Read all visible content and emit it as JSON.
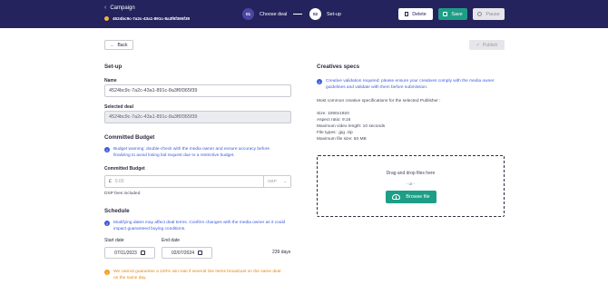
{
  "header": {
    "breadcrumb": "Campaign",
    "deal_id": "4524bc9c-7a2c-43a1-891c-8a3f6f365f39",
    "steps": [
      {
        "num": "01",
        "label": "Choose deal"
      },
      {
        "num": "02",
        "label": "Set-up"
      }
    ],
    "buttons": {
      "delete": "Delete",
      "save": "Save",
      "pause": "Pause"
    }
  },
  "toolbar": {
    "back": "Back",
    "publish": "Publish"
  },
  "setup": {
    "title": "Set-up",
    "name_label": "Name",
    "name_value": "4524bc9c-7a2c-43a1-891c-8a3f6f365f39",
    "selected_deal_label": "Selected deal",
    "selected_deal_value": "4524bc9c-7a2c-43a1-891c-8a3f6f365f39"
  },
  "budget": {
    "title": "Committed Budget",
    "warning": "Budget warning: double-check with the media owner and ensure accuracy before finalizing to avoid losing bid request due to a restrictive budget.",
    "field_label": "Committed Budget",
    "currency_symbol": "£",
    "placeholder": "0.00",
    "currency": "GBP",
    "dsp_note": "DSP fees included"
  },
  "schedule": {
    "title": "Schedule",
    "info": "Modifying dates may affect deal terms. Confirm changes with the media owner as it could impact guaranteed buying conditions.",
    "start_label": "Start date",
    "start_value": "07/11/2023",
    "end_label": "End date",
    "end_value": "02/07/2024",
    "duration": "239 days",
    "warning": "We cannot guarantee a 100% win-rate if several line items broadcast on the same deal on the same day."
  },
  "creatives": {
    "title": "Creatives specs",
    "info": "Creative validation required: please ensure your creatives comply with the media owner guidelines and validate with them before submission.",
    "common_title": "Most common creative specifications for the selected Publisher :",
    "specs": [
      "Size: 1080x1920",
      "Aspect ratio: 9:16",
      "Maximum video length: 10 seconds",
      "File types: .jpg .zip",
      "Maximum file size: 50 MB"
    ],
    "drop_text": "Drag and drop files here",
    "or_text": "- or -",
    "browse": "Browse file"
  },
  "colors": {
    "header_bg": "#25235e",
    "accent": "#1e9e86",
    "info": "#3b5bdb",
    "warning": "#e8870b"
  }
}
